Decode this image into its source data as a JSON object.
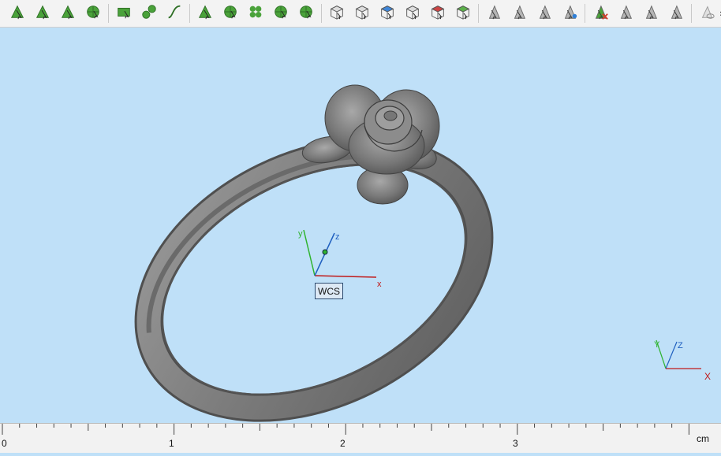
{
  "toolbar": {
    "groups": [
      [
        "draw-curve-icon",
        "draw-polygon-icon",
        "draw-spline-icon",
        "draw-circle-icon"
      ],
      [
        "rectangle-icon",
        "two-circles-icon",
        "free-curve-icon"
      ],
      [
        "pattern-icon",
        "radial-icon",
        "flower-icon",
        "sphere-split-icon",
        "rotate-icon"
      ],
      [
        "box-view-icon",
        "box-shaded-icon",
        "box-color-icon",
        "box-wire-icon",
        "box-red-icon",
        "box-green-icon"
      ],
      [
        "arrow-select-icon",
        "shape-select-icon",
        "move-select-icon",
        "paint-select-icon"
      ],
      [
        "delete-select-icon",
        "shape-gray-icon",
        "copy-shape-icon",
        "layer-icon"
      ],
      [
        "eye-icon"
      ]
    ],
    "more_label": "»"
  },
  "viewport": {
    "wcs_label": "WCS",
    "axis_x": "x",
    "axis_y": "y",
    "axis_z": "z",
    "corner_x": "X",
    "corner_y": "Y",
    "corner_z": "Z"
  },
  "ruler": {
    "labels": [
      "0",
      "1",
      "2",
      "3"
    ],
    "unit": "cm"
  },
  "colors": {
    "background": "#bfe0f8",
    "axis_x": "#c01a1a",
    "axis_y": "#2fb32f",
    "axis_z": "#2060c0",
    "ring": "#8a8a8a"
  }
}
